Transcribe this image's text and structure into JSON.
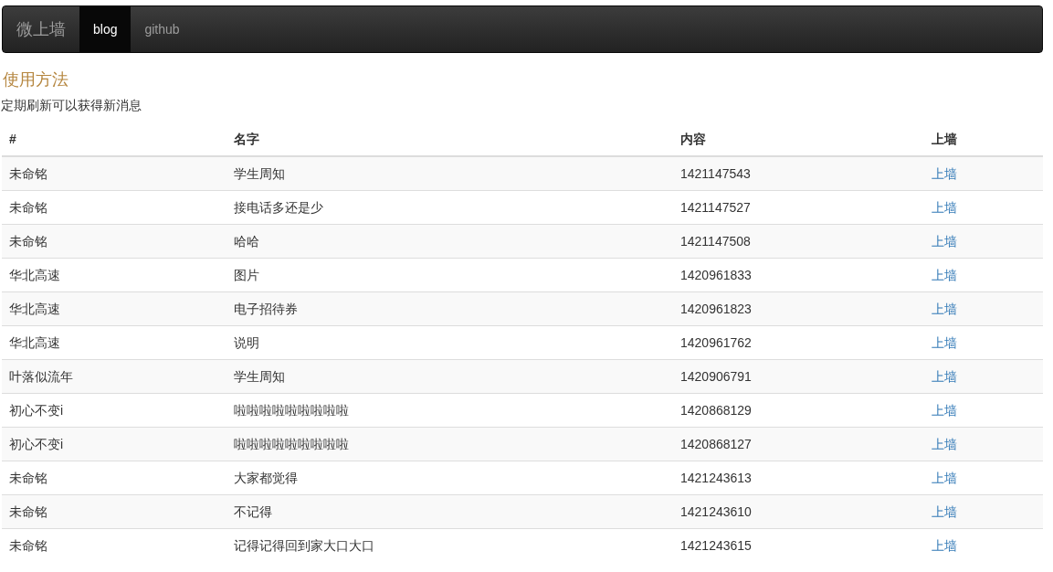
{
  "navbar": {
    "brand": "微上墙",
    "items": [
      {
        "label": "blog",
        "selected": true
      },
      {
        "label": "github",
        "selected": false
      }
    ]
  },
  "heading": "使用方法",
  "description": "定期刷新可以获得新消息",
  "table": {
    "columns": [
      "#",
      "名字",
      "内容",
      "上墙"
    ],
    "rows": [
      {
        "author": "未命铭",
        "name": "学生周知",
        "content": "1421147543",
        "action": "上墙"
      },
      {
        "author": "未命铭",
        "name": "接电话多还是少",
        "content": "1421147527",
        "action": "上墙"
      },
      {
        "author": "未命铭",
        "name": "哈哈",
        "content": "1421147508",
        "action": "上墙"
      },
      {
        "author": "华北高速",
        "name": "图片",
        "content": "1420961833",
        "action": "上墙"
      },
      {
        "author": "华北高速",
        "name": "电子招待券",
        "content": "1420961823",
        "action": "上墙"
      },
      {
        "author": "华北高速",
        "name": "说明",
        "content": "1420961762",
        "action": "上墙"
      },
      {
        "author": "叶落似流年",
        "name": "学生周知",
        "content": "1420906791",
        "action": "上墙"
      },
      {
        "author": "初心不变i",
        "name": "啦啦啦啦啦啦啦啦啦",
        "content": "1420868129",
        "action": "上墙"
      },
      {
        "author": "初心不变i",
        "name": "啦啦啦啦啦啦啦啦啦",
        "content": "1420868127",
        "action": "上墙"
      },
      {
        "author": "未命铭",
        "name": "大家都觉得",
        "content": "1421243613",
        "action": "上墙"
      },
      {
        "author": "未命铭",
        "name": "不记得",
        "content": "1421243610",
        "action": "上墙"
      },
      {
        "author": "未命铭",
        "name": "记得记得回到家大口大口",
        "content": "1421243615",
        "action": "上墙"
      }
    ]
  }
}
